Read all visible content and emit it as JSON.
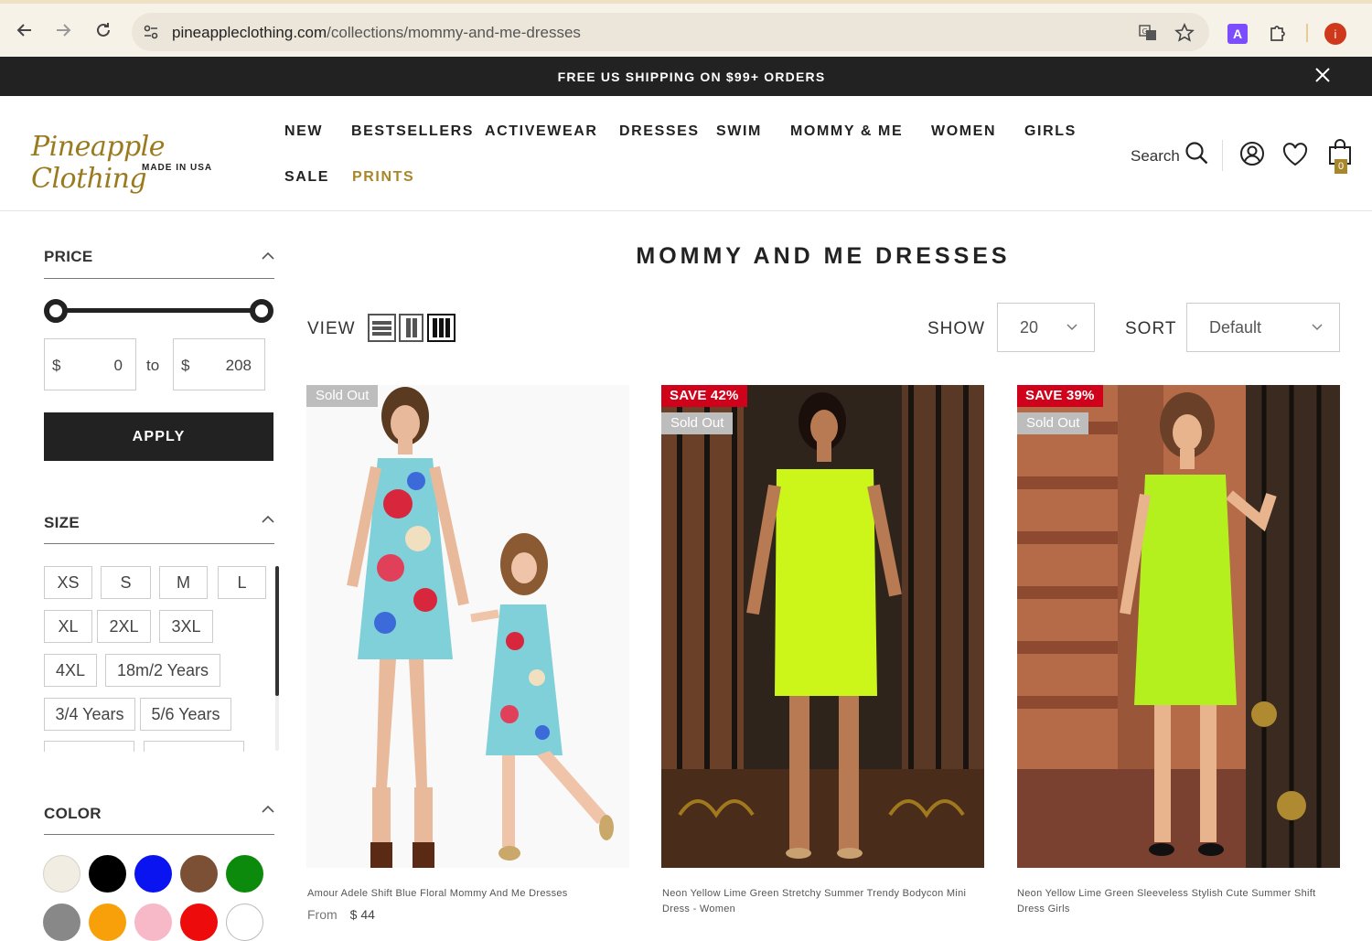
{
  "browser": {
    "url_domain": "pineappleclothing.com",
    "url_path": "/collections/mommy-and-me-dresses",
    "ext_label": "A",
    "profile_initial": "i"
  },
  "promo": {
    "text": "FREE US SHIPPING ON $99+ ORDERS"
  },
  "header": {
    "logo_script": "Pineapple Clothing",
    "logo_sub": "MADE IN USA",
    "nav": [
      "NEW",
      "BESTSELLERS",
      "ACTIVEWEAR",
      "DRESSES",
      "SWIM",
      "MOMMY & ME",
      "WOMEN",
      "GIRLS",
      "SALE",
      "PRINTS"
    ],
    "search_label": "Search",
    "cart_count": "0"
  },
  "sidebar": {
    "price": {
      "title": "PRICE",
      "currency": "$",
      "min": "0",
      "max": "208",
      "to_label": "to",
      "apply_label": "APPLY"
    },
    "size": {
      "title": "SIZE",
      "options": [
        "XS",
        "S",
        "M",
        "L",
        "XL",
        "2XL",
        "3XL",
        "4XL",
        "18m/2 Years",
        "3/4 Years",
        "5/6 Years"
      ]
    },
    "color": {
      "title": "COLOR",
      "swatches": [
        "#f1ede3",
        "#000000",
        "#0a14f0",
        "#7b5035",
        "#0b8a0b",
        "#888888",
        "#f7a00a",
        "#f7b8c8",
        "#ee0b0b",
        "#ffffff"
      ]
    }
  },
  "main": {
    "title": "MOMMY AND ME DRESSES",
    "view_label": "VIEW",
    "show_label": "SHOW",
    "show_value": "20",
    "sort_label": "SORT",
    "sort_value": "Default",
    "products": [
      {
        "name": "Amour Adele Shift Blue Floral Mommy And Me Dresses",
        "badges": {
          "sold": "Sold Out"
        },
        "price_prefix": "From",
        "price": "$ 44"
      },
      {
        "name": "Neon Yellow Lime Green Stretchy Summer Trendy Bodycon Mini Dress - Women",
        "badges": {
          "save": "SAVE 42%",
          "sold": "Sold Out"
        }
      },
      {
        "name": "Neon Yellow Lime Green Sleeveless Stylish Cute Summer Shift Dress Girls",
        "badges": {
          "save": "SAVE 39%",
          "sold": "Sold Out"
        }
      }
    ]
  }
}
